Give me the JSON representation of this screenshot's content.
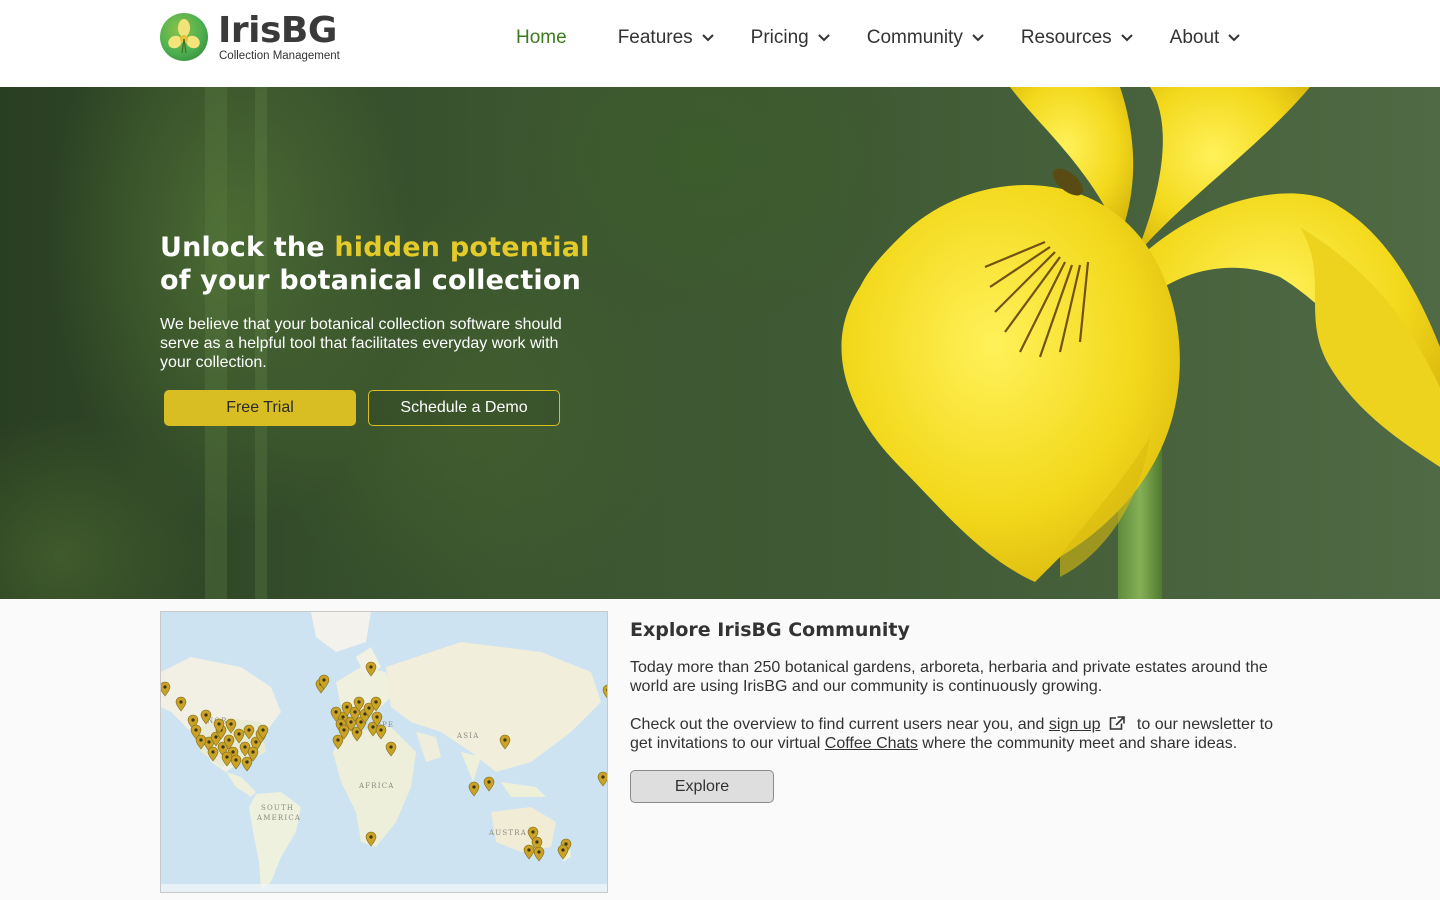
{
  "brand": {
    "name": "IrisBG",
    "subtitle": "Collection Management"
  },
  "nav": {
    "items": [
      {
        "label": "Home",
        "active": true,
        "dropdown": false
      },
      {
        "label": "Features",
        "dropdown": true
      },
      {
        "label": "Pricing",
        "dropdown": true
      },
      {
        "label": "Community",
        "dropdown": true
      },
      {
        "label": "Resources",
        "dropdown": true
      },
      {
        "label": "About",
        "dropdown": true
      }
    ]
  },
  "hero": {
    "headline_part1": "Unlock the ",
    "headline_highlight": "hidden potential",
    "headline_part2": "of your botanical collection",
    "body": "We believe that your botanical collection software should serve as a helpful tool that facilitates everyday work with your collection.",
    "primary_button": "Free Trial",
    "secondary_button": "Schedule a Demo"
  },
  "community": {
    "title": "Explore IrisBG Community",
    "paragraph1": "Today more than 250 botanical gardens, arboreta, herbaria and private estates around the world are using IrisBG and our community is continuously growing.",
    "p2_before": "Check out the overview to find current users near you, and ",
    "p2_link1": "sign up",
    "p2_middle": " to our newsletter to get invitations to our virtual ",
    "p2_link2": "Coffee Chats",
    "p2_after": " where the community meet and share ideas.",
    "button": "Explore",
    "map_labels": {
      "north_america": "NOR",
      "europe": "OPE",
      "asia": "ASIA",
      "africa": "AFRICA",
      "south_america_1": "SOUTH",
      "south_america_2": "AMERICA",
      "australia": "AUSTRA"
    }
  },
  "colors": {
    "accent_yellow": "#d8be22",
    "nav_active_green": "#3c7a20",
    "map_marker": "#c9a227"
  },
  "icons": {
    "nav_dropdown": "chevron-down-icon",
    "external_link": "external-link-icon",
    "map_marker": "map-pin-icon"
  }
}
